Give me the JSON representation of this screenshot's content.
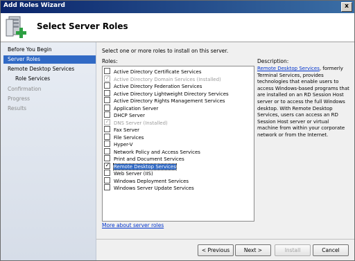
{
  "window": {
    "title": "Add Roles Wizard",
    "close_glyph": "x"
  },
  "header": {
    "title": "Select Server Roles",
    "icon": "server-add-icon"
  },
  "nav": {
    "items": [
      {
        "label": "Before You Begin",
        "state": "normal"
      },
      {
        "label": "Server Roles",
        "state": "selected"
      },
      {
        "label": "Remote Desktop Services",
        "state": "normal"
      },
      {
        "label": "Role Services",
        "state": "sub"
      },
      {
        "label": "Confirmation",
        "state": "dim"
      },
      {
        "label": "Progress",
        "state": "dim"
      },
      {
        "label": "Results",
        "state": "dim"
      }
    ]
  },
  "main": {
    "instruction": "Select one or more roles to install on this server.",
    "roles_label": "Roles:",
    "roles": [
      {
        "label": "Active Directory Certificate Services",
        "checked": false,
        "disabled": false
      },
      {
        "label": "Active Directory Domain Services  (Installed)",
        "checked": true,
        "disabled": true
      },
      {
        "label": "Active Directory Federation Services",
        "checked": false,
        "disabled": false
      },
      {
        "label": "Active Directory Lightweight Directory Services",
        "checked": false,
        "disabled": false
      },
      {
        "label": "Active Directory Rights Management Services",
        "checked": false,
        "disabled": false
      },
      {
        "label": "Application Server",
        "checked": false,
        "disabled": false
      },
      {
        "label": "DHCP Server",
        "checked": false,
        "disabled": false
      },
      {
        "label": "DNS Server  (Installed)",
        "checked": true,
        "disabled": true
      },
      {
        "label": "Fax Server",
        "checked": false,
        "disabled": false
      },
      {
        "label": "File Services",
        "checked": false,
        "disabled": false
      },
      {
        "label": "Hyper-V",
        "checked": false,
        "disabled": false
      },
      {
        "label": "Network Policy and Access Services",
        "checked": false,
        "disabled": false
      },
      {
        "label": "Print and Document Services",
        "checked": false,
        "disabled": false
      },
      {
        "label": "Remote Desktop Services",
        "checked": true,
        "disabled": false,
        "highlighted": true
      },
      {
        "label": "Web Server (IIS)",
        "checked": false,
        "disabled": false
      },
      {
        "label": "Windows Deployment Services",
        "checked": false,
        "disabled": false
      },
      {
        "label": "Windows Server Update Services",
        "checked": false,
        "disabled": false
      }
    ],
    "more_link": "More about server roles",
    "description_label": "Description:",
    "description_link": "Remote Desktop Services",
    "description_text": ", formerly Terminal Services, provides technologies that enable users to access Windows-based programs that are installed on an RD Session Host server or to access the full Windows desktop. With Remote Desktop Services, users can access an RD Session Host server or virtual machine from within your corporate network or from the Internet."
  },
  "buttons": {
    "previous": "< Previous",
    "next": "Next >",
    "install": "Install",
    "cancel": "Cancel"
  }
}
